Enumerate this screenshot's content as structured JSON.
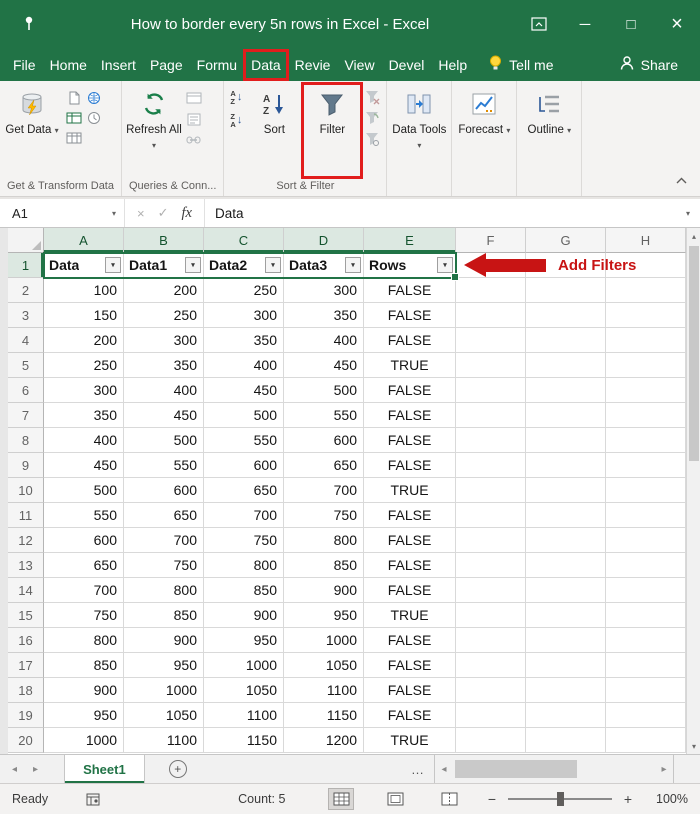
{
  "colors": {
    "excel_green": "#217346",
    "highlight_red": "#e11d1d",
    "annotation_red": "#c81414"
  },
  "title_bar": {
    "title": "How to border every 5n rows in Excel  -  Excel"
  },
  "ribbon": {
    "tabs": [
      {
        "label": "File"
      },
      {
        "label": "Home"
      },
      {
        "label": "Insert"
      },
      {
        "label": "Page"
      },
      {
        "label": "Formu"
      },
      {
        "label": "Data",
        "highlighted": true
      },
      {
        "label": "Revie"
      },
      {
        "label": "View"
      },
      {
        "label": "Devel"
      },
      {
        "label": "Help"
      }
    ],
    "tell_me": "Tell me",
    "share": "Share",
    "get_data": "Get Data",
    "refresh_all": "Refresh All",
    "sort": "Sort",
    "filter": "Filter",
    "data_tools": "Data Tools",
    "forecast": "Forecast",
    "outline": "Outline",
    "group_labels": [
      "Get & Transform Data",
      "Queries & Conn...",
      "Sort & Filter"
    ]
  },
  "formula_bar": {
    "name_box": "A1",
    "fx_label": "fx",
    "value": "Data"
  },
  "grid": {
    "columns": [
      "A",
      "B",
      "C",
      "D",
      "E",
      "F",
      "G",
      "H"
    ],
    "selected_columns": [
      "A",
      "B",
      "C",
      "D",
      "E"
    ],
    "row_numbers": [
      1,
      2,
      3,
      4,
      5,
      6,
      7,
      8,
      9,
      10,
      11,
      12,
      13,
      14,
      15,
      16,
      17,
      18,
      19,
      20
    ],
    "filter_headers": [
      "Data",
      "Data1",
      "Data2",
      "Data3",
      "Rows"
    ],
    "rows": [
      [
        "100",
        "200",
        "250",
        "300",
        "FALSE"
      ],
      [
        "150",
        "250",
        "300",
        "350",
        "FALSE"
      ],
      [
        "200",
        "300",
        "350",
        "400",
        "FALSE"
      ],
      [
        "250",
        "350",
        "400",
        "450",
        "TRUE"
      ],
      [
        "300",
        "400",
        "450",
        "500",
        "FALSE"
      ],
      [
        "350",
        "450",
        "500",
        "550",
        "FALSE"
      ],
      [
        "400",
        "500",
        "550",
        "600",
        "FALSE"
      ],
      [
        "450",
        "550",
        "600",
        "650",
        "FALSE"
      ],
      [
        "500",
        "600",
        "650",
        "700",
        "TRUE"
      ],
      [
        "550",
        "650",
        "700",
        "750",
        "FALSE"
      ],
      [
        "600",
        "700",
        "750",
        "800",
        "FALSE"
      ],
      [
        "650",
        "750",
        "800",
        "850",
        "FALSE"
      ],
      [
        "700",
        "800",
        "850",
        "900",
        "FALSE"
      ],
      [
        "750",
        "850",
        "900",
        "950",
        "TRUE"
      ],
      [
        "800",
        "900",
        "950",
        "1000",
        "FALSE"
      ],
      [
        "850",
        "950",
        "1000",
        "1050",
        "FALSE"
      ],
      [
        "900",
        "1000",
        "1050",
        "1100",
        "FALSE"
      ],
      [
        "950",
        "1050",
        "1100",
        "1150",
        "FALSE"
      ],
      [
        "1000",
        "1100",
        "1150",
        "1200",
        "TRUE"
      ]
    ]
  },
  "annotation": {
    "label": "Add Filters"
  },
  "sheet_bar": {
    "tabs": [
      {
        "label": "Sheet1",
        "active": true
      }
    ]
  },
  "status_bar": {
    "mode": "Ready",
    "count": "Count: 5",
    "zoom": "100%"
  },
  "icons": {
    "dropdown": "▾",
    "window_minimize": "─",
    "window_maximize": "□",
    "window_close": "×",
    "check": "✓",
    "cancel": "×",
    "nav_left": "◂",
    "nav_right": "▸",
    "nav_up": "▴",
    "nav_down": "▾",
    "more": "…",
    "zoom_in": "+",
    "zoom_out": "−",
    "sort_letter_a": "A",
    "sort_letter_z": "Z",
    "arrow_down": "↓"
  }
}
